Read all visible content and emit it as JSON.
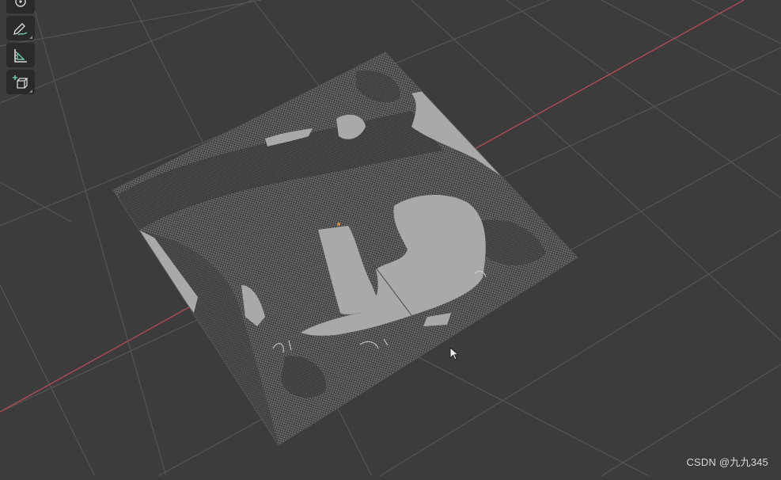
{
  "viewport": {
    "background_color": "#3c3c3c",
    "grid_color": "#545454",
    "x_axis_color": "#b04a55",
    "terrain_fill_color": "#a9a9a9",
    "terrain_mesh_color": "#5a5a5a"
  },
  "toolbar": {
    "tools": [
      {
        "name": "cursor-tool",
        "icon": "cursor-crosshair-icon"
      },
      {
        "name": "annotate-tool",
        "icon": "annotate-pen-icon"
      },
      {
        "name": "measure-tool",
        "icon": "measure-ruler-icon"
      },
      {
        "name": "add-cube-tool",
        "icon": "add-cube-icon"
      }
    ]
  },
  "watermark": {
    "text": "CSDN @九九345"
  }
}
